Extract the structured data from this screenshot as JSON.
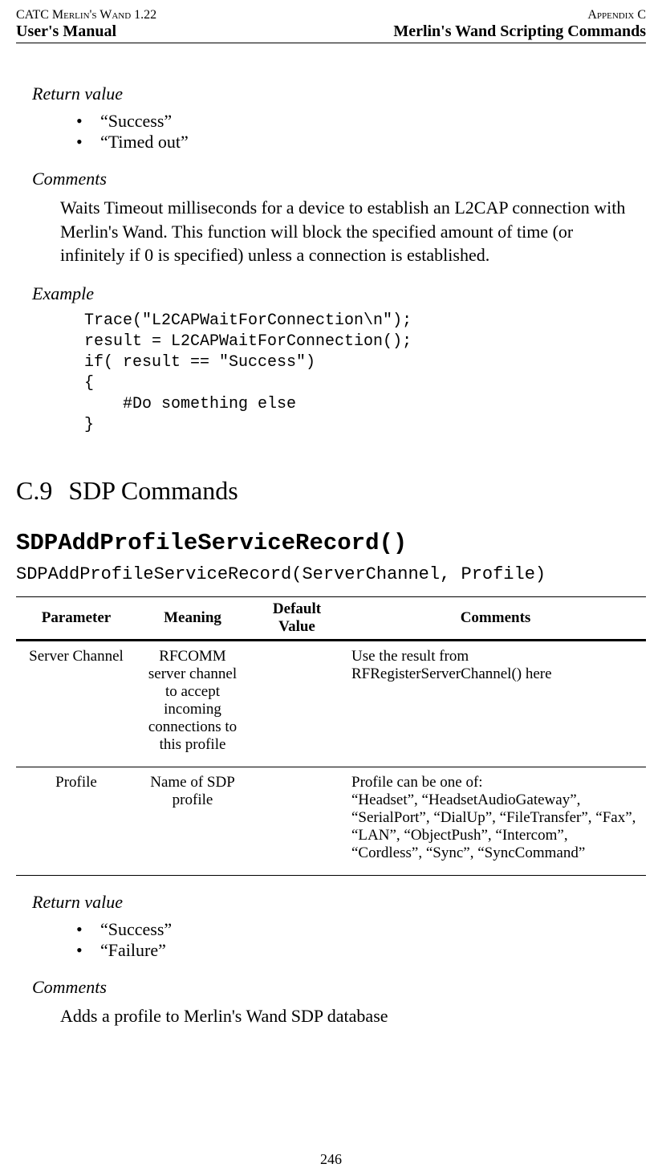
{
  "header": {
    "top_left": "CATC Merlin's Wand 1.22",
    "bottom_left": "User's Manual",
    "top_right": "Appendix C",
    "bottom_right": "Merlin's Wand Scripting Commands"
  },
  "section1": {
    "return_label": "Return value",
    "return_items": [
      "“Success”",
      "“Timed out”"
    ],
    "comments_label": "Comments",
    "comments_text": "Waits Timeout milliseconds for a device to establish an L2CAP connection with Merlin's Wand. This function will block the specified amount of time (or infinitely if 0 is specified) unless a connection is established.",
    "example_label": "Example",
    "example_code": "Trace(\"L2CAPWaitForConnection\\n\");\nresult = L2CAPWaitForConnection();\nif( result == \"Success\")\n{\n    #Do something else\n}"
  },
  "chapter": {
    "number": "C.9",
    "title": "SDP Commands"
  },
  "func": {
    "name": "SDPAddProfileServiceRecord()",
    "signature": "SDPAddProfileServiceRecord(ServerChannel, Profile)"
  },
  "table": {
    "headers": [
      "Parameter",
      "Meaning",
      "Default Value",
      "Comments"
    ],
    "rows": [
      {
        "parameter": "Server Channel",
        "meaning": "RFCOMM server channel to accept incoming connections to this profile",
        "default": "",
        "comments": "Use the result from RFRegisterServerChannel() here"
      },
      {
        "parameter": "Profile",
        "meaning": "Name of SDP profile",
        "default": "",
        "comments": "Profile can be one of:\n“Headset”, “HeadsetAudioGateway”, “SerialPort”, “DialUp”, “FileTransfer”, “Fax”, “LAN”, “ObjectPush”, “Intercom”, “Cordless”, “Sync”, “SyncCommand”"
      }
    ]
  },
  "section2": {
    "return_label": "Return value",
    "return_items": [
      "“Success”",
      "“Failure”"
    ],
    "comments_label": "Comments",
    "comments_text": "Adds a profile to Merlin's Wand SDP database"
  },
  "page_number": "246"
}
